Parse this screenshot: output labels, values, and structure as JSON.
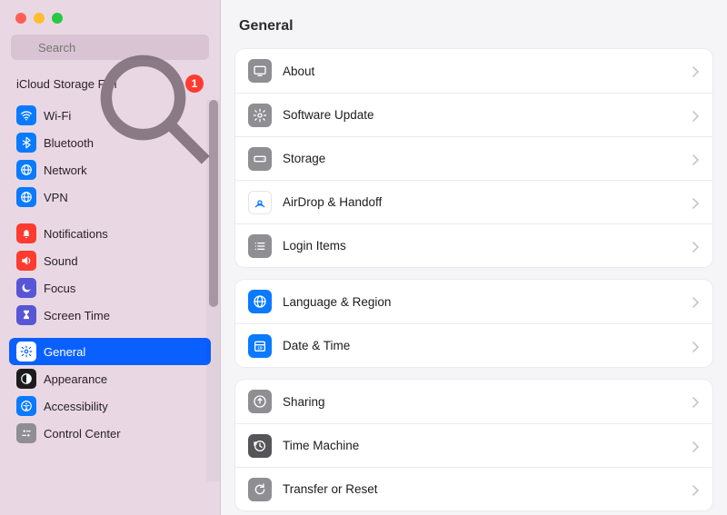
{
  "search": {
    "placeholder": "Search"
  },
  "status": {
    "text": "iCloud Storage Full",
    "badge": "1"
  },
  "sidebar": {
    "groups": [
      {
        "items": [
          {
            "id": "wifi",
            "label": "Wi-Fi",
            "icon": "wifi",
            "color": "blue"
          },
          {
            "id": "bluetooth",
            "label": "Bluetooth",
            "icon": "bluetooth",
            "color": "blue"
          },
          {
            "id": "network",
            "label": "Network",
            "icon": "globe",
            "color": "blue"
          },
          {
            "id": "vpn",
            "label": "VPN",
            "icon": "globe",
            "color": "blue"
          }
        ]
      },
      {
        "items": [
          {
            "id": "notifications",
            "label": "Notifications",
            "icon": "bell",
            "color": "red"
          },
          {
            "id": "sound",
            "label": "Sound",
            "icon": "speaker",
            "color": "red"
          },
          {
            "id": "focus",
            "label": "Focus",
            "icon": "moon",
            "color": "purple"
          },
          {
            "id": "screentime",
            "label": "Screen Time",
            "icon": "hourglass",
            "color": "purple"
          }
        ]
      },
      {
        "items": [
          {
            "id": "general",
            "label": "General",
            "icon": "gear",
            "color": "gray",
            "selected": true
          },
          {
            "id": "appearance",
            "label": "Appearance",
            "icon": "appearance",
            "color": "black"
          },
          {
            "id": "accessibility",
            "label": "Accessibility",
            "icon": "accessibility",
            "color": "blue"
          },
          {
            "id": "controlcenter",
            "label": "Control Center",
            "icon": "switches",
            "color": "gray"
          }
        ]
      }
    ]
  },
  "page": {
    "title": "General"
  },
  "sections": [
    {
      "rows": [
        {
          "id": "about",
          "label": "About",
          "icon": "display",
          "color": "gray"
        },
        {
          "id": "softwareupdate",
          "label": "Software Update",
          "icon": "gear-badge",
          "color": "gray"
        },
        {
          "id": "storage",
          "label": "Storage",
          "icon": "disk",
          "color": "gray"
        },
        {
          "id": "airdrop",
          "label": "AirDrop & Handoff",
          "icon": "airdrop",
          "color": "white-blue"
        },
        {
          "id": "loginitems",
          "label": "Login Items",
          "icon": "list",
          "color": "gray"
        }
      ]
    },
    {
      "rows": [
        {
          "id": "language",
          "label": "Language & Region",
          "icon": "globe",
          "color": "blue"
        },
        {
          "id": "datetime",
          "label": "Date & Time",
          "icon": "calendar",
          "color": "blue"
        }
      ]
    },
    {
      "rows": [
        {
          "id": "sharing",
          "label": "Sharing",
          "icon": "share",
          "color": "gray"
        },
        {
          "id": "timemachine",
          "label": "Time Machine",
          "icon": "clock-arrow",
          "color": "gray-dark"
        },
        {
          "id": "transfer",
          "label": "Transfer or Reset",
          "icon": "reset",
          "color": "gray"
        }
      ]
    }
  ]
}
